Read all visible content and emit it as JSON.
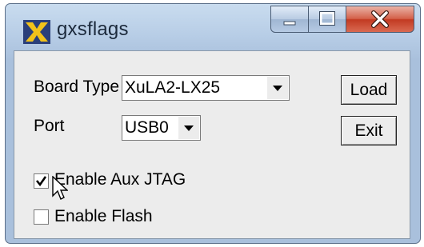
{
  "window": {
    "title": "gxsflags"
  },
  "board_type": {
    "label": "Board Type",
    "value": "XuLA2-LX25"
  },
  "port": {
    "label": "Port",
    "value": "USB0"
  },
  "buttons": {
    "load": "Load",
    "exit": "Exit"
  },
  "options": {
    "aux_jtag": {
      "label": "Enable Aux JTAG",
      "checked": true
    },
    "flash": {
      "label": "Enable Flash",
      "checked": false
    }
  },
  "icons": {
    "app": "xsflags-x-icon",
    "minimize": "minimize-icon",
    "maximize": "maximize-icon",
    "close": "close-icon",
    "cursor": "mouse-cursor"
  },
  "colors": {
    "close_button": "#c23a22",
    "titlebar": "#b7cde6",
    "client": "#ececec"
  }
}
